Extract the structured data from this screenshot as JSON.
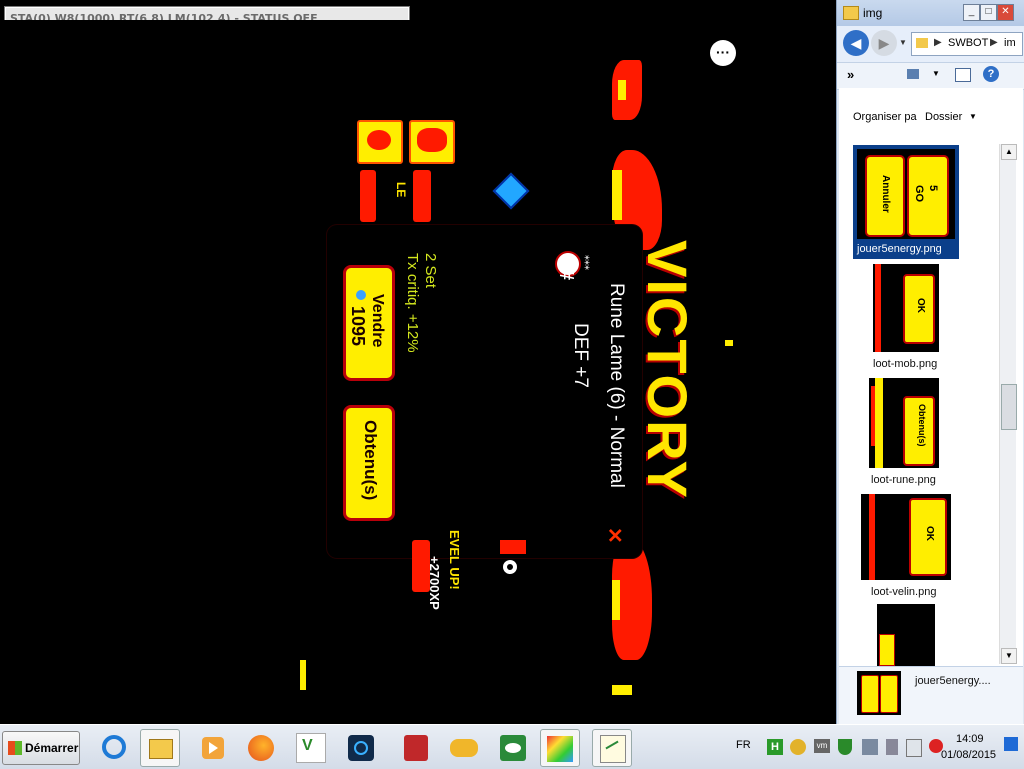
{
  "status_bar": {
    "text": "STA(0) W8(1000) RT(6.8) LM(102.4) - STATUS OFF"
  },
  "game": {
    "victory": "VICTORY",
    "rune_title": "Rune Lame (6) - Normal",
    "rune_stat": "DEF +7",
    "set_info": "2 Set",
    "set_bonus": "Tx critiq. +12%",
    "sell_label": "Vendre",
    "sell_price": "1095",
    "obtain_label": "Obtenu(s)",
    "level_up": "EVEL UP!",
    "xp": "+2700XP",
    "side_label": "LE",
    "stars": "⁎⁎⁎",
    "hash": "#"
  },
  "explorer": {
    "title": "img",
    "breadcrumb": "SWBOT",
    "breadcrumb_tail": "im",
    "more": "»",
    "organize_label": "Organiser pa",
    "sort_value": "Dossier",
    "files": [
      {
        "name": "jouer5energy.png"
      },
      {
        "name": "loot-mob.png"
      },
      {
        "name": "loot-rune.png"
      },
      {
        "name": "loot-velin.png"
      }
    ],
    "status_file": "jouer5energy....",
    "thumb_text": {
      "annuler": "Annuler",
      "go": "GO",
      "five": "5",
      "ok": "OK",
      "obtenus": "Obtenu(s)"
    }
  },
  "taskbar": {
    "start_label": "Démarrer",
    "lang": "FR",
    "time": "14:09",
    "date": "01/08/2015"
  },
  "colors": {
    "accent_red": "#ff1a00",
    "accent_yellow": "#ffee00",
    "explorer_selected": "#0b3f8a"
  }
}
